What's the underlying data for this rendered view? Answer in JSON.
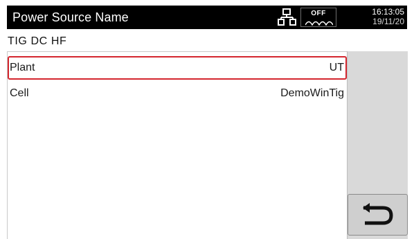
{
  "header": {
    "title": "Power Source Name",
    "off_label": "OFF",
    "time": "16:13:05",
    "date": "19/11/20",
    "icons": {
      "network": "network-icon",
      "off": "arc-off-icon"
    }
  },
  "subtitle": "TIG  DC  HF",
  "list": {
    "rows": [
      {
        "label": "Plant",
        "value": "UT",
        "selected": true
      },
      {
        "label": "Cell",
        "value": "DemoWinTig",
        "selected": false
      }
    ]
  },
  "side_panel": {
    "back_icon": "return-icon"
  },
  "colors": {
    "header_bg": "#000000",
    "selection_border": "#d4262e",
    "panel_bg": "#d9d9d9"
  }
}
